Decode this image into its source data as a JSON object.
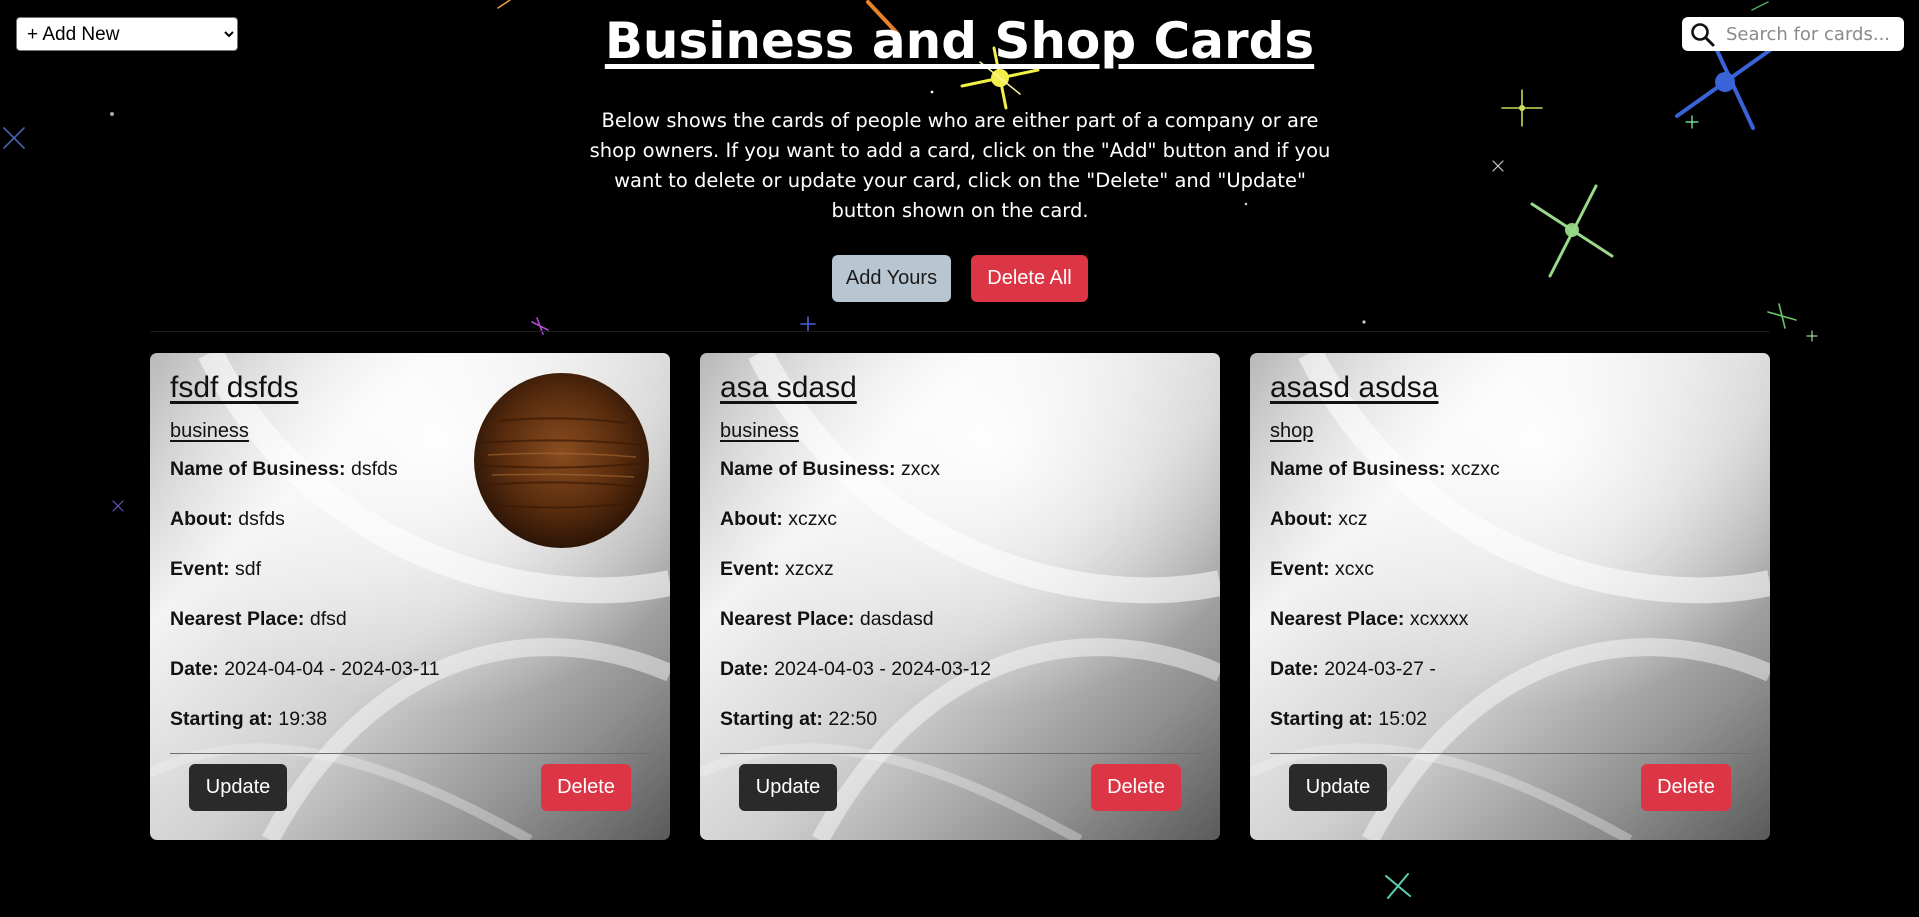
{
  "toolbar": {
    "add_select_value": "+ Add New",
    "search_placeholder": "Search for cards..."
  },
  "header": {
    "title": "Business and Shop Cards",
    "intro": "Below shows the cards of people who are either part of a company or are shop owners. If you want to add a card, click on the \"Add\" button and if you want to delete or update your card, click on the \"Delete\" and \"Update\" button shown on the card.",
    "add_yours_label": "Add Yours",
    "delete_all_label": "Delete All"
  },
  "labels": {
    "business_name": "Name of Business:",
    "about": "About:",
    "event": "Event:",
    "nearest_place": "Nearest Place:",
    "date": "Date:",
    "starting_at": "Starting at:",
    "update": "Update",
    "delete": "Delete"
  },
  "cards": [
    {
      "name": "fsdf dsfds",
      "category": "business",
      "business_name": "dsfds",
      "about": "dsfds",
      "event": "sdf",
      "nearest_place": "dfsd",
      "date": "2024-04-04 - 2024-03-11",
      "starting_at": "19:38"
    },
    {
      "name": "asa sdasd",
      "category": "business",
      "business_name": "zxcx",
      "about": "xczxc",
      "event": "xzcxz",
      "nearest_place": "dasdasd",
      "date": "2024-04-03 - 2024-03-12",
      "starting_at": "22:50"
    },
    {
      "name": "asasd asdsa",
      "category": "shop",
      "business_name": "xczxc",
      "about": "xcz",
      "event": "xcxc",
      "nearest_place": "xcxxxx",
      "date": "2024-03-27 -",
      "starting_at": "15:02"
    }
  ],
  "colors": {
    "background": "#000000",
    "delete_red": "#dc3545",
    "add_yours_bg": "#b8c6d1",
    "update_bg": "#2a2a2a"
  }
}
